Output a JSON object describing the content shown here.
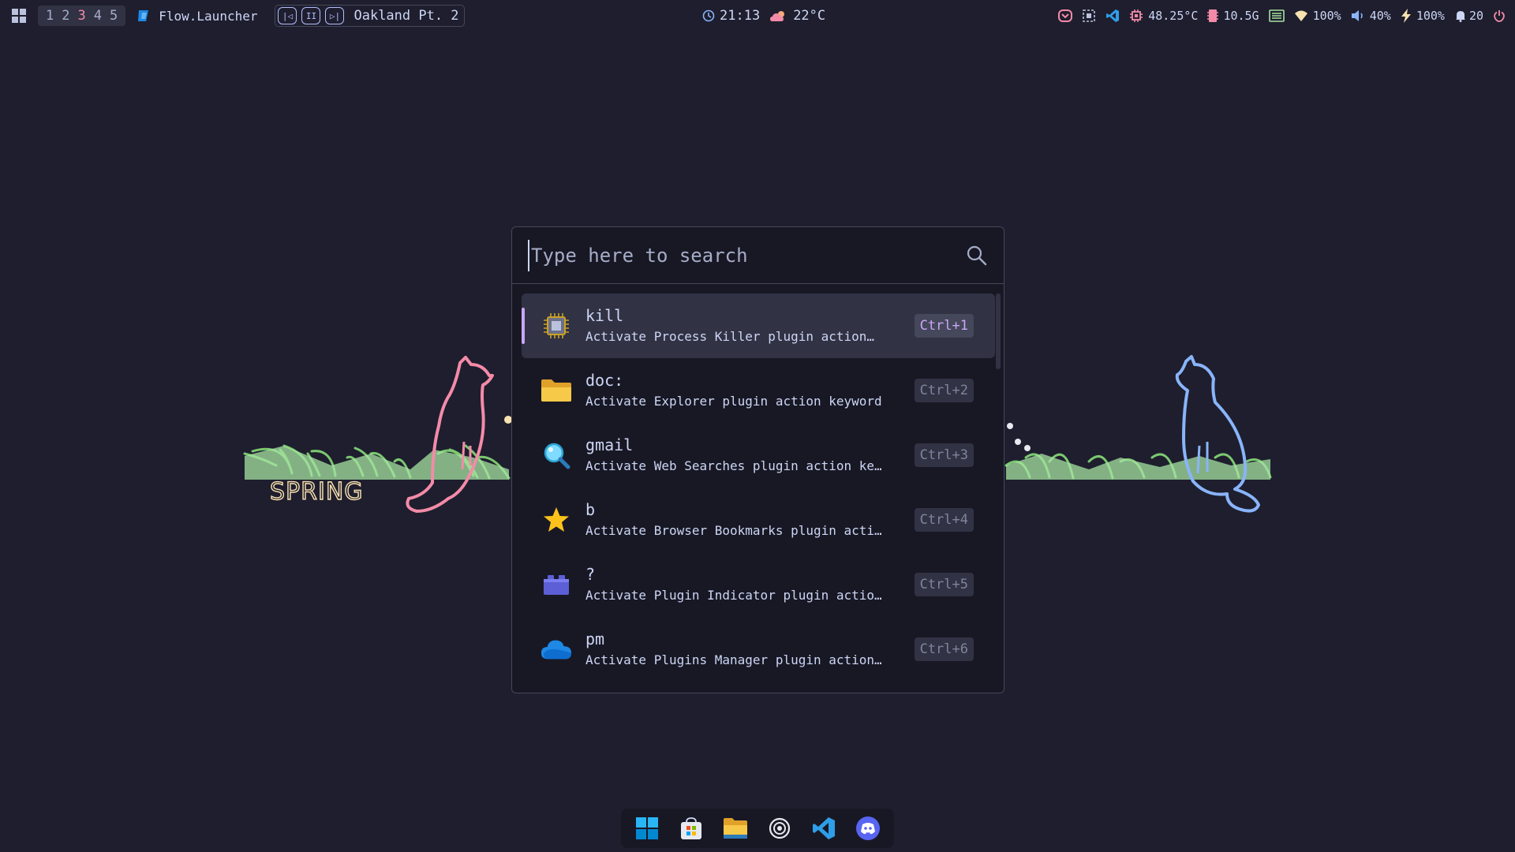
{
  "topbar": {
    "workspaces": [
      "1",
      "2",
      "3",
      "4",
      "5"
    ],
    "active_workspace": "3",
    "focused_app": "Flow.Launcher",
    "media": {
      "track": "Oakland Pt. 2",
      "buttons": [
        "previous",
        "pause",
        "next"
      ]
    },
    "clock": "21:13",
    "weather": "22°C",
    "cpu_temp": "48.25°C",
    "memory": "10.5G",
    "wifi": "100%",
    "volume": "40%",
    "battery": "100%",
    "notifications": "20"
  },
  "wallpaper": {
    "label": "SPRING"
  },
  "launcher": {
    "placeholder": "Type here to search",
    "results": [
      {
        "title": "kill",
        "subtitle": "Activate Process Killer plugin action…",
        "hotkey": "Ctrl+1",
        "icon": "cpu-icon",
        "selected": true
      },
      {
        "title": "doc:",
        "subtitle": "Activate Explorer plugin action keyword",
        "hotkey": "Ctrl+2",
        "icon": "folder-icon",
        "selected": false
      },
      {
        "title": "gmail",
        "subtitle": "Activate Web Searches plugin action ke…",
        "hotkey": "Ctrl+3",
        "icon": "magnifier-icon",
        "selected": false
      },
      {
        "title": "b",
        "subtitle": "Activate Browser Bookmarks plugin acti…",
        "hotkey": "Ctrl+4",
        "icon": "star-icon",
        "selected": false
      },
      {
        "title": "?",
        "subtitle": "Activate Plugin Indicator plugin actio…",
        "hotkey": "Ctrl+5",
        "icon": "brick-icon",
        "selected": false
      },
      {
        "title": "pm",
        "subtitle": "Activate Plugins Manager plugin action…",
        "hotkey": "Ctrl+6",
        "icon": "cloud-icon",
        "selected": false
      }
    ]
  },
  "dock": [
    "windows-icon",
    "store-icon",
    "explorer-icon",
    "obs-icon",
    "vscode-icon",
    "discord-icon"
  ],
  "colors": {
    "background": "#1e1e2e",
    "accent": "#cba6f7",
    "pink": "#f38ba8",
    "blue": "#89b4fa",
    "green": "#a6e3a1",
    "yellow": "#f9e2af"
  }
}
